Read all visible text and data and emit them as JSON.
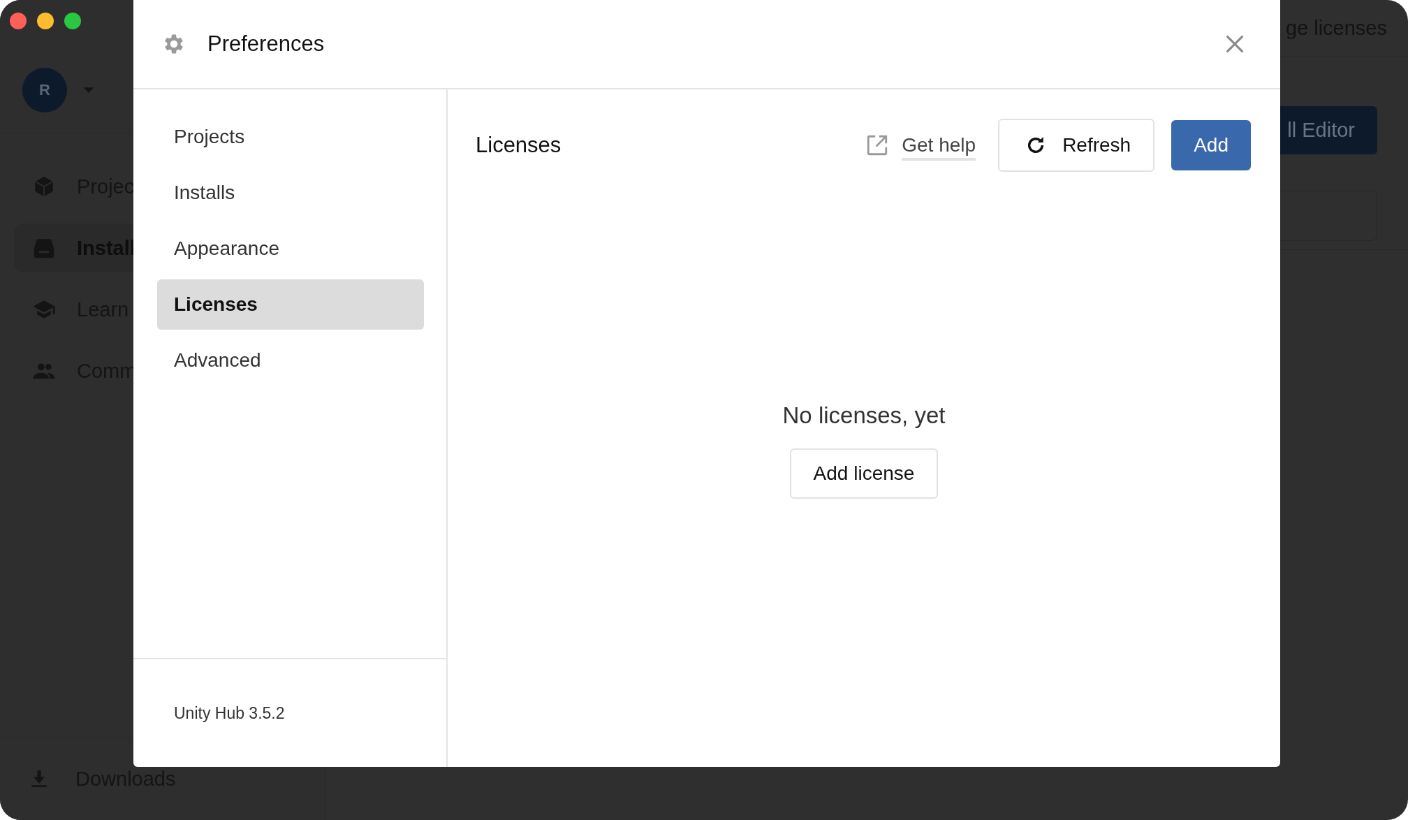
{
  "background": {
    "avatar": "R",
    "sidebar_items": [
      {
        "label": "Projec",
        "selected": false
      },
      {
        "label": "Install",
        "selected": true
      },
      {
        "label": "Learn",
        "selected": false
      },
      {
        "label": "Comm",
        "selected": false
      }
    ],
    "downloads": "Downloads",
    "header_text": "ge licenses",
    "install_button": "ll Editor"
  },
  "dialog": {
    "title": "Preferences",
    "nav": [
      {
        "label": "Projects",
        "selected": false
      },
      {
        "label": "Installs",
        "selected": false
      },
      {
        "label": "Appearance",
        "selected": false
      },
      {
        "label": "Licenses",
        "selected": true
      },
      {
        "label": "Advanced",
        "selected": false
      }
    ],
    "version": "Unity Hub 3.5.2",
    "content": {
      "title": "Licenses",
      "get_help": "Get help",
      "refresh": "Refresh",
      "add": "Add",
      "empty_message": "No licenses, yet",
      "add_license": "Add license"
    }
  }
}
